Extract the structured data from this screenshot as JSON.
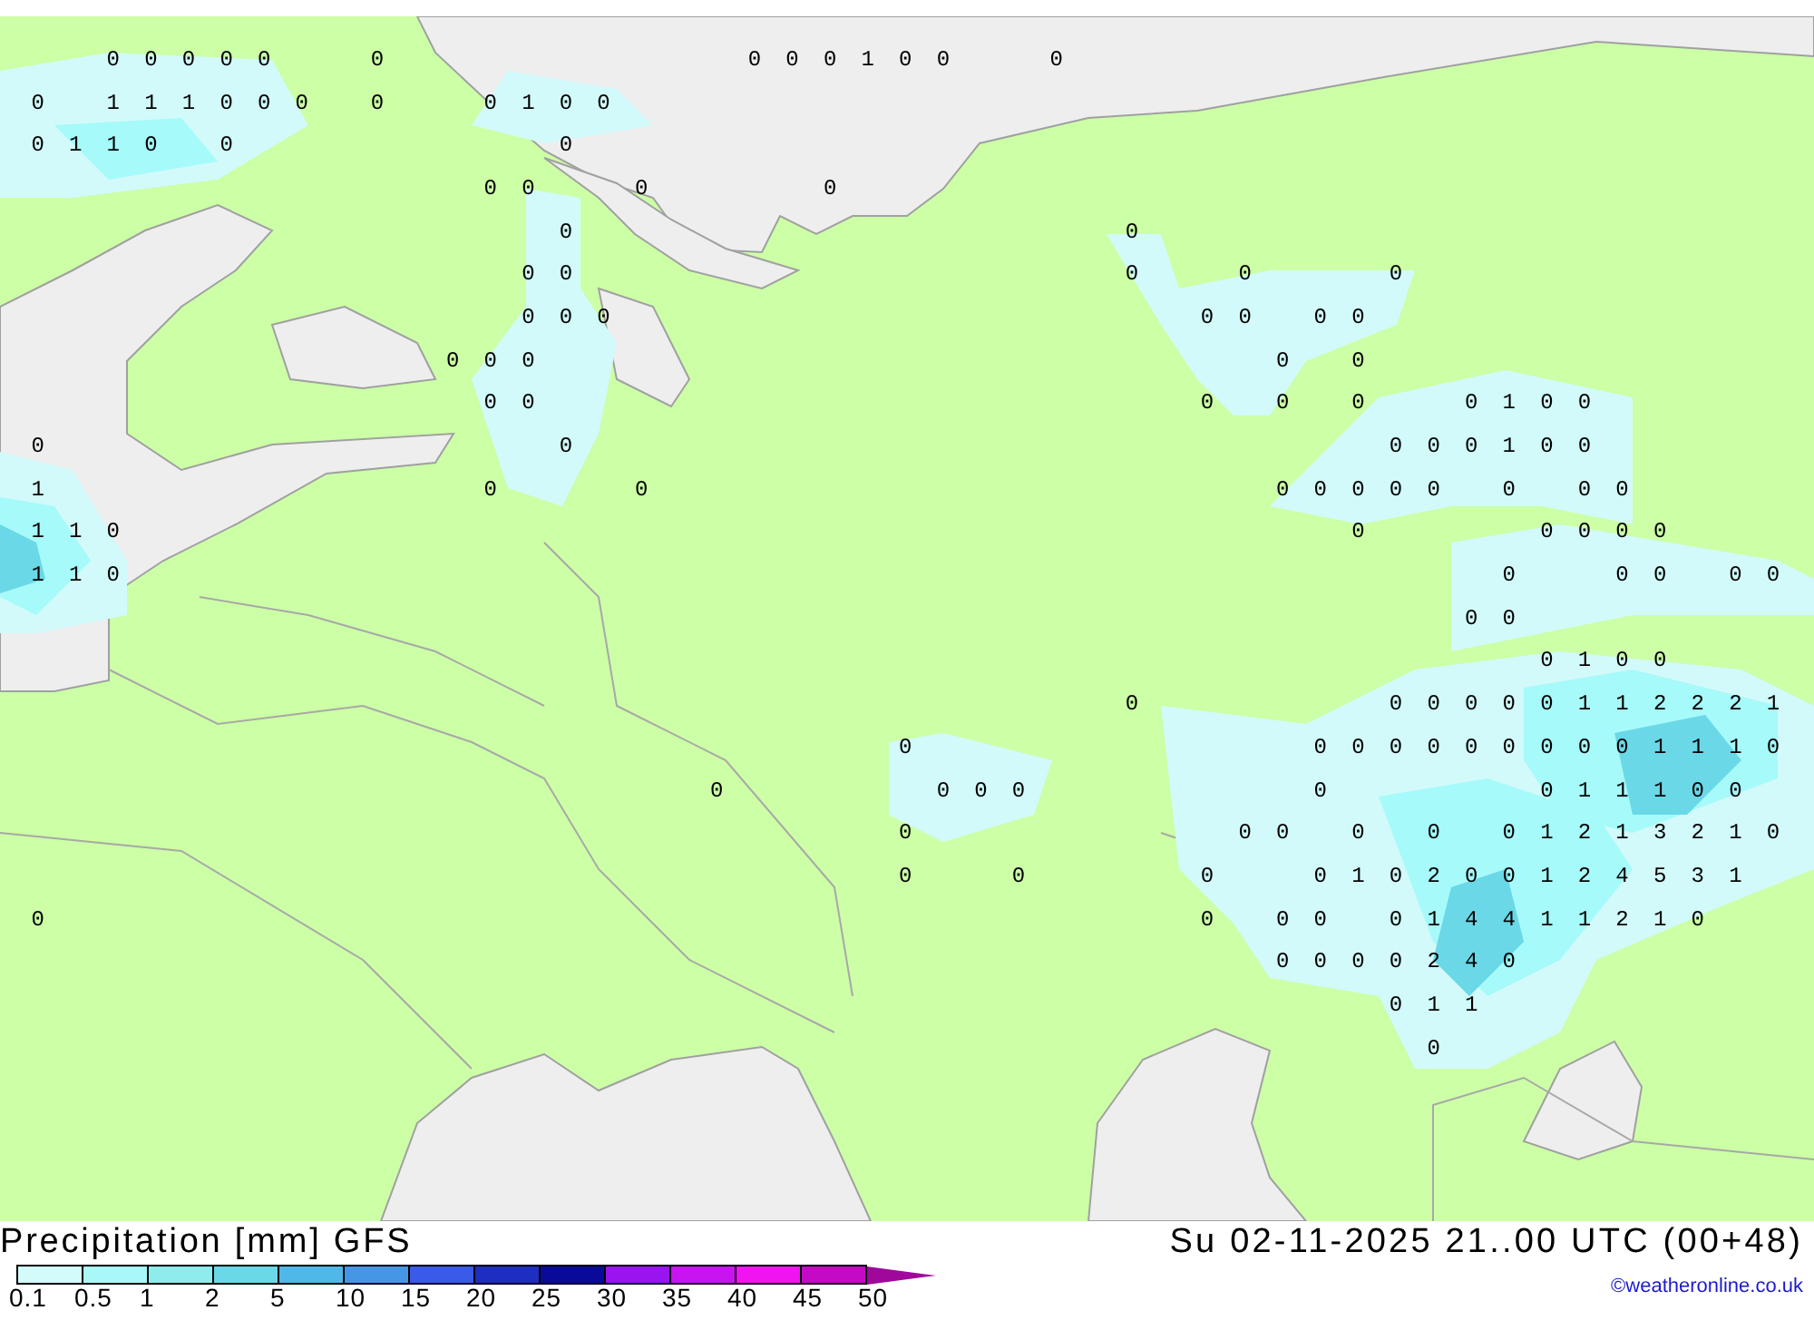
{
  "map": {
    "value_rows": [
      [
        null,
        null,
        null,
        "0",
        "0",
        "0",
        "0",
        "0",
        null,
        null,
        "0",
        null,
        null,
        null,
        null,
        null,
        null,
        null,
        null,
        null,
        "0",
        "0",
        "0",
        "1",
        "0",
        "0",
        null,
        null,
        "0"
      ],
      [
        null,
        "0",
        null,
        "1",
        "1",
        "1",
        "0",
        "0",
        "0",
        null,
        "0",
        null,
        null,
        "0",
        "1",
        "0",
        "0"
      ],
      [
        null,
        "0",
        "1",
        "1",
        "0",
        null,
        "0",
        null,
        null,
        null,
        null,
        null,
        null,
        null,
        null,
        "0"
      ],
      [
        null,
        null,
        null,
        null,
        null,
        null,
        null,
        null,
        null,
        null,
        null,
        null,
        null,
        "0",
        "0",
        null,
        null,
        "0",
        null,
        null,
        null,
        null,
        "0"
      ],
      [
        null,
        null,
        null,
        null,
        null,
        null,
        null,
        null,
        null,
        null,
        null,
        null,
        null,
        null,
        null,
        "0",
        null,
        null,
        null,
        null,
        null,
        null,
        null,
        null,
        null,
        null,
        null,
        null,
        null,
        null,
        "0"
      ],
      [
        null,
        null,
        null,
        null,
        null,
        null,
        null,
        null,
        null,
        null,
        null,
        null,
        null,
        null,
        "0",
        "0",
        null,
        null,
        null,
        null,
        null,
        null,
        null,
        null,
        null,
        null,
        null,
        null,
        null,
        null,
        "0",
        null,
        null,
        "0",
        null,
        null,
        null,
        "0"
      ],
      [
        null,
        null,
        null,
        null,
        null,
        null,
        null,
        null,
        null,
        null,
        null,
        null,
        null,
        null,
        "0",
        "0",
        "0",
        null,
        null,
        null,
        null,
        null,
        null,
        null,
        null,
        null,
        null,
        null,
        null,
        null,
        null,
        null,
        "0",
        "0",
        null,
        "0",
        "0"
      ],
      [
        null,
        null,
        null,
        null,
        null,
        null,
        null,
        null,
        null,
        null,
        null,
        null,
        "0",
        "0",
        "0",
        null,
        null,
        null,
        null,
        null,
        null,
        null,
        null,
        null,
        null,
        null,
        null,
        null,
        null,
        null,
        null,
        null,
        null,
        null,
        "0",
        null,
        "0"
      ],
      [
        null,
        null,
        null,
        null,
        null,
        null,
        null,
        null,
        null,
        null,
        null,
        null,
        null,
        "0",
        "0",
        null,
        null,
        null,
        null,
        null,
        null,
        null,
        null,
        null,
        null,
        null,
        null,
        null,
        null,
        null,
        null,
        null,
        "0",
        null,
        "0",
        null,
        "0",
        null,
        null,
        "0",
        "1",
        "0",
        "0"
      ],
      [
        null,
        "0",
        null,
        null,
        null,
        null,
        null,
        null,
        null,
        null,
        null,
        null,
        null,
        null,
        null,
        "0",
        null,
        null,
        null,
        null,
        null,
        null,
        null,
        null,
        null,
        null,
        null,
        null,
        null,
        null,
        null,
        null,
        null,
        null,
        null,
        null,
        null,
        "0",
        "0",
        "0",
        "1",
        "0",
        "0"
      ],
      [
        null,
        "1",
        null,
        null,
        null,
        null,
        null,
        null,
        null,
        null,
        null,
        null,
        null,
        "0",
        null,
        null,
        null,
        "0",
        null,
        null,
        null,
        null,
        null,
        null,
        null,
        null,
        null,
        null,
        null,
        null,
        null,
        null,
        null,
        null,
        "0",
        "0",
        "0",
        "0",
        "0",
        null,
        "0",
        null,
        "0",
        "0"
      ],
      [
        null,
        "1",
        "1",
        "0",
        null,
        null,
        null,
        null,
        null,
        null,
        null,
        null,
        null,
        null,
        null,
        null,
        null,
        null,
        null,
        null,
        null,
        null,
        null,
        null,
        null,
        null,
        null,
        null,
        null,
        null,
        null,
        null,
        null,
        null,
        null,
        null,
        "0",
        null,
        null,
        null,
        null,
        "0",
        "0",
        "0",
        "0"
      ],
      [
        null,
        "1",
        "1",
        "0",
        null,
        null,
        null,
        null,
        null,
        null,
        null,
        null,
        null,
        null,
        null,
        null,
        null,
        null,
        null,
        null,
        null,
        null,
        null,
        null,
        null,
        null,
        null,
        null,
        null,
        null,
        null,
        null,
        null,
        null,
        null,
        null,
        null,
        null,
        null,
        null,
        "0",
        null,
        null,
        "0",
        "0",
        null,
        "0",
        "0"
      ],
      [
        null,
        null,
        null,
        null,
        null,
        null,
        null,
        null,
        null,
        null,
        null,
        null,
        null,
        null,
        null,
        null,
        null,
        null,
        null,
        null,
        null,
        null,
        null,
        null,
        null,
        null,
        null,
        null,
        null,
        null,
        null,
        null,
        null,
        null,
        null,
        null,
        null,
        null,
        null,
        "0",
        "0"
      ],
      [
        null,
        null,
        null,
        null,
        null,
        null,
        null,
        null,
        null,
        null,
        null,
        null,
        null,
        null,
        null,
        null,
        null,
        null,
        null,
        null,
        null,
        null,
        null,
        null,
        null,
        null,
        null,
        null,
        null,
        null,
        null,
        null,
        null,
        null,
        null,
        null,
        null,
        null,
        null,
        null,
        null,
        "0",
        "1",
        "0",
        "0"
      ],
      [
        null,
        null,
        null,
        null,
        null,
        null,
        null,
        null,
        null,
        null,
        null,
        null,
        null,
        null,
        null,
        null,
        null,
        null,
        null,
        null,
        null,
        null,
        null,
        null,
        null,
        null,
        null,
        null,
        null,
        null,
        "0",
        null,
        null,
        null,
        null,
        null,
        null,
        "0",
        "0",
        "0",
        "0",
        "0",
        "1",
        "1",
        "2",
        "2",
        "2",
        "1"
      ],
      [
        null,
        null,
        null,
        null,
        null,
        null,
        null,
        null,
        null,
        null,
        null,
        null,
        null,
        null,
        null,
        null,
        null,
        null,
        null,
        null,
        null,
        null,
        null,
        null,
        "0",
        null,
        null,
        null,
        null,
        null,
        null,
        null,
        null,
        null,
        null,
        "0",
        "0",
        "0",
        "0",
        "0",
        "0",
        "0",
        "0",
        "0",
        "1",
        "1",
        "1",
        "0"
      ],
      [
        null,
        null,
        null,
        null,
        null,
        null,
        null,
        null,
        null,
        null,
        null,
        null,
        null,
        null,
        null,
        null,
        null,
        null,
        null,
        "0",
        null,
        null,
        null,
        null,
        null,
        "0",
        "0",
        "0",
        null,
        null,
        null,
        null,
        null,
        null,
        null,
        "0",
        null,
        null,
        null,
        null,
        null,
        "0",
        "1",
        "1",
        "1",
        "0",
        "0"
      ],
      [
        null,
        null,
        null,
        null,
        null,
        null,
        null,
        null,
        null,
        null,
        null,
        null,
        null,
        null,
        null,
        null,
        null,
        null,
        null,
        null,
        null,
        null,
        null,
        null,
        "0",
        null,
        null,
        null,
        null,
        null,
        null,
        null,
        null,
        "0",
        "0",
        null,
        "0",
        null,
        "0",
        null,
        "0",
        "1",
        "2",
        "1",
        "3",
        "2",
        "1",
        "0"
      ],
      [
        null,
        null,
        null,
        null,
        null,
        null,
        null,
        null,
        null,
        null,
        null,
        null,
        null,
        null,
        null,
        null,
        null,
        null,
        null,
        null,
        null,
        null,
        null,
        null,
        "0",
        null,
        null,
        "0",
        null,
        null,
        null,
        null,
        "0",
        null,
        null,
        "0",
        "1",
        "0",
        "2",
        "0",
        "0",
        "1",
        "2",
        "4",
        "5",
        "3",
        "1"
      ],
      [
        null,
        "0",
        null,
        null,
        null,
        null,
        null,
        null,
        null,
        null,
        null,
        null,
        null,
        null,
        null,
        null,
        null,
        null,
        null,
        null,
        null,
        null,
        null,
        null,
        null,
        null,
        null,
        null,
        null,
        null,
        null,
        null,
        "0",
        null,
        "0",
        "0",
        null,
        "0",
        "1",
        "4",
        "4",
        "1",
        "1",
        "2",
        "1",
        "0"
      ],
      [
        null,
        null,
        null,
        null,
        null,
        null,
        null,
        null,
        null,
        null,
        null,
        null,
        null,
        null,
        null,
        null,
        null,
        null,
        null,
        null,
        null,
        null,
        null,
        null,
        null,
        null,
        null,
        null,
        null,
        null,
        null,
        null,
        null,
        null,
        "0",
        "0",
        "0",
        "0",
        "2",
        "4",
        "0"
      ],
      [
        null,
        null,
        null,
        null,
        null,
        null,
        null,
        null,
        null,
        null,
        null,
        null,
        null,
        null,
        null,
        null,
        null,
        null,
        null,
        null,
        null,
        null,
        null,
        null,
        null,
        null,
        null,
        null,
        null,
        null,
        null,
        null,
        null,
        null,
        null,
        null,
        null,
        "0",
        "1",
        "1"
      ],
      [
        null,
        null,
        null,
        null,
        null,
        null,
        null,
        null,
        null,
        null,
        null,
        null,
        null,
        null,
        null,
        null,
        null,
        null,
        null,
        null,
        null,
        null,
        null,
        null,
        null,
        null,
        null,
        null,
        null,
        null,
        null,
        null,
        null,
        null,
        null,
        null,
        null,
        null,
        "0"
      ]
    ]
  },
  "legend": {
    "title": "Precipitation [mm] GFS",
    "swatches": [
      {
        "color": "#d4fbfb"
      },
      {
        "color": "#a8f8f8"
      },
      {
        "color": "#8eecec"
      },
      {
        "color": "#6ad8e6"
      },
      {
        "color": "#50b8e8"
      },
      {
        "color": "#4696e6"
      },
      {
        "color": "#3a5ae8"
      },
      {
        "color": "#1e2ec0"
      },
      {
        "color": "#0a0a9a"
      },
      {
        "color": "#9a14f0"
      },
      {
        "color": "#c814f0"
      },
      {
        "color": "#f014f0"
      },
      {
        "color": "#c40ac4"
      }
    ],
    "ticks": [
      "0.1",
      "0.5",
      "1",
      "2",
      "5",
      "10",
      "15",
      "20",
      "25",
      "30",
      "35",
      "40",
      "45",
      "50"
    ],
    "valid_time": "Su 02-11-2025 21..00 UTC (00+48)",
    "credit": "©weatheronline.co.uk"
  }
}
